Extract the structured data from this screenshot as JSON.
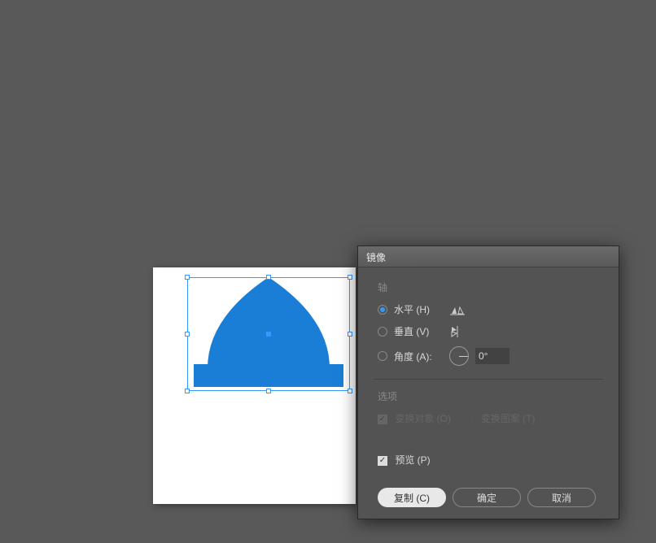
{
  "dialog": {
    "title": "镜像",
    "axis": {
      "section_label": "轴",
      "horizontal_label": "水平 (H)",
      "vertical_label": "垂直 (V)",
      "angle_label": "角度 (A):",
      "angle_value": "0°",
      "selected": "horizontal"
    },
    "options": {
      "section_label": "选项",
      "transform_objects_label": "变换对象 (O)",
      "transform_objects_checked": true,
      "transform_patterns_label": "变换图案 (T)",
      "transform_patterns_checked": false
    },
    "preview": {
      "label": "预览 (P)",
      "checked": true
    },
    "buttons": {
      "copy": "复制 (C)",
      "ok": "确定",
      "cancel": "取消"
    }
  },
  "canvas": {
    "shape_color": "#1a7ed6",
    "selection_color": "#3399ff"
  }
}
